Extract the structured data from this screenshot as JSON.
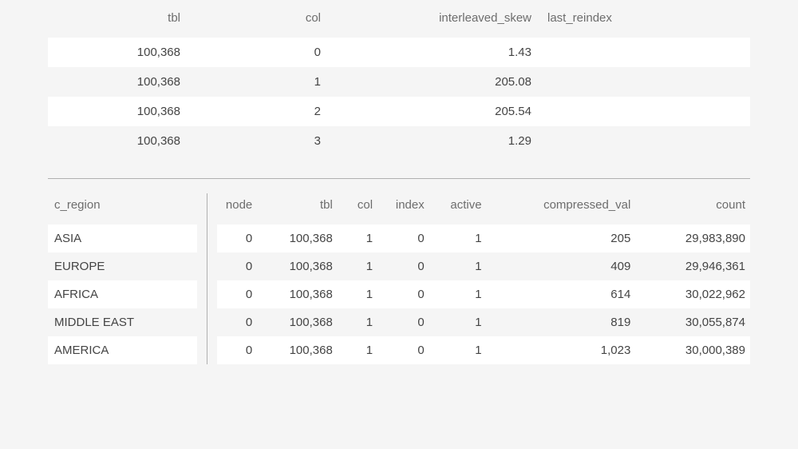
{
  "chart_data": [
    {
      "type": "table",
      "title": "",
      "columns": [
        "tbl",
        "col",
        "interleaved_skew",
        "last_reindex"
      ],
      "rows": [
        [
          "100,368",
          "0",
          "1.43",
          ""
        ],
        [
          "100,368",
          "1",
          "205.08",
          ""
        ],
        [
          "100,368",
          "2",
          "205.54",
          ""
        ],
        [
          "100,368",
          "3",
          "1.29",
          ""
        ]
      ]
    },
    {
      "type": "table",
      "title": "",
      "columns": [
        "c_region",
        "node",
        "tbl",
        "col",
        "index",
        "active",
        "compressed_val",
        "count"
      ],
      "rows": [
        [
          "ASIA",
          "0",
          "100,368",
          "1",
          "0",
          "1",
          "205",
          "29,983,890"
        ],
        [
          "EUROPE",
          "0",
          "100,368",
          "1",
          "0",
          "1",
          "409",
          "29,946,361"
        ],
        [
          "AFRICA",
          "0",
          "100,368",
          "1",
          "0",
          "1",
          "614",
          "30,022,962"
        ],
        [
          "MIDDLE EAST",
          "0",
          "100,368",
          "1",
          "0",
          "1",
          "819",
          "30,055,874"
        ],
        [
          "AMERICA",
          "0",
          "100,368",
          "1",
          "0",
          "1",
          "1,023",
          "30,000,389"
        ]
      ]
    }
  ],
  "top_table": {
    "headers": {
      "tbl": "tbl",
      "col": "col",
      "skew": "interleaved_skew",
      "reindex": "last_reindex"
    },
    "rows": [
      {
        "tbl": "100,368",
        "col": "0",
        "skew": "1.43",
        "reindex": ""
      },
      {
        "tbl": "100,368",
        "col": "1",
        "skew": "205.08",
        "reindex": ""
      },
      {
        "tbl": "100,368",
        "col": "2",
        "skew": "205.54",
        "reindex": ""
      },
      {
        "tbl": "100,368",
        "col": "3",
        "skew": "1.29",
        "reindex": ""
      }
    ]
  },
  "left_table": {
    "header": "c_region",
    "rows": [
      "ASIA",
      "EUROPE",
      "AFRICA",
      "MIDDLE EAST",
      "AMERICA"
    ]
  },
  "right_table": {
    "headers": {
      "node": "node",
      "tbl": "tbl",
      "col": "col",
      "index": "index",
      "active": "active",
      "cval": "compressed_val",
      "count": "count"
    },
    "rows": [
      {
        "node": "0",
        "tbl": "100,368",
        "col": "1",
        "index": "0",
        "active": "1",
        "cval": "205",
        "count": "29,983,890"
      },
      {
        "node": "0",
        "tbl": "100,368",
        "col": "1",
        "index": "0",
        "active": "1",
        "cval": "409",
        "count": "29,946,361"
      },
      {
        "node": "0",
        "tbl": "100,368",
        "col": "1",
        "index": "0",
        "active": "1",
        "cval": "614",
        "count": "30,022,962"
      },
      {
        "node": "0",
        "tbl": "100,368",
        "col": "1",
        "index": "0",
        "active": "1",
        "cval": "819",
        "count": "30,055,874"
      },
      {
        "node": "0",
        "tbl": "100,368",
        "col": "1",
        "index": "0",
        "active": "1",
        "cval": "1,023",
        "count": "30,000,389"
      }
    ]
  }
}
